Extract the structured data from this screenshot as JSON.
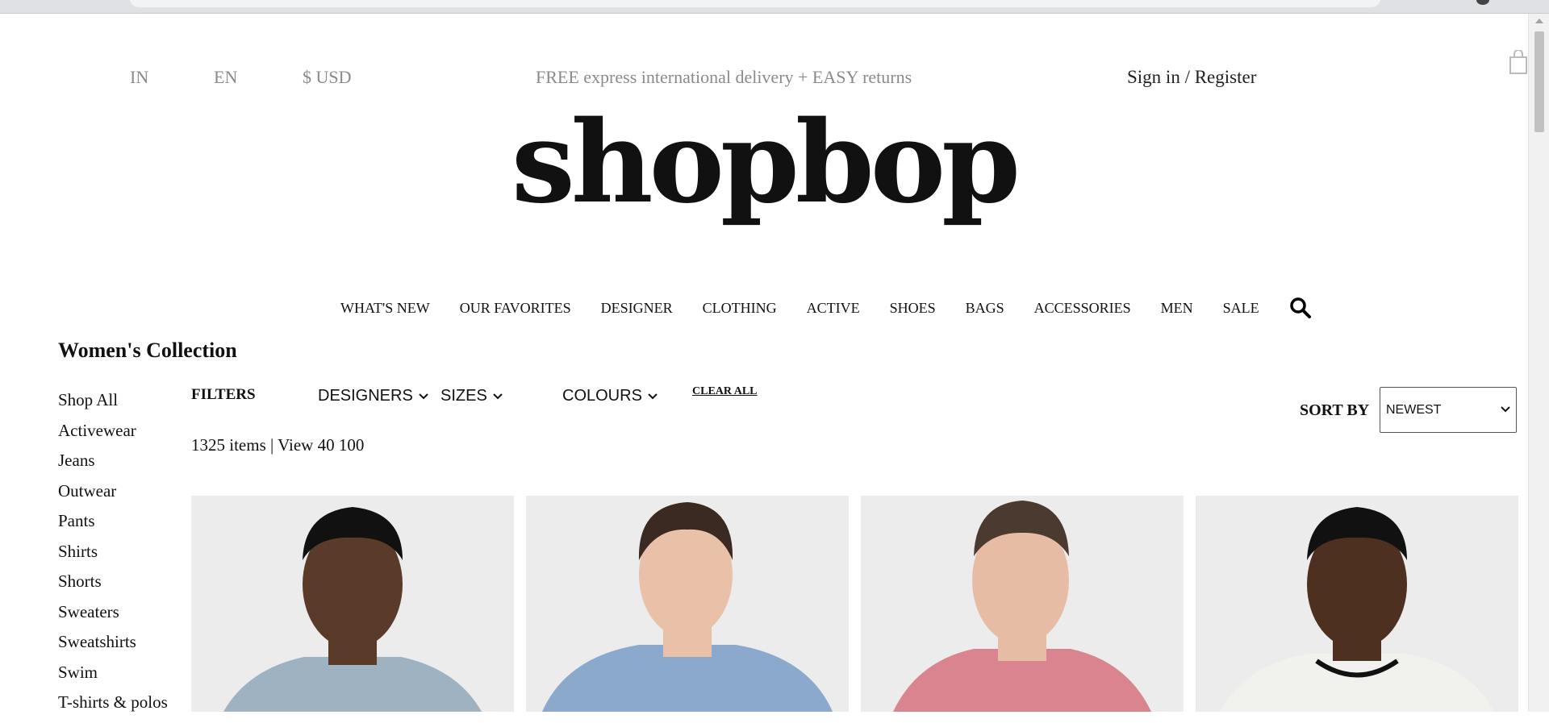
{
  "topbar": {
    "country": "IN",
    "language": "EN",
    "currency": "$ USD",
    "promo": "FREE express international delivery + EASY returns",
    "signin": "Sign in / Register"
  },
  "logo": {
    "text": "shopbop"
  },
  "nav": {
    "items": [
      "WHAT'S NEW",
      "OUR FAVORITES",
      "DESIGNER",
      "CLOTHING",
      "ACTIVE",
      "SHOES",
      "BAGS",
      "ACCESSORIES",
      "MEN",
      "SALE"
    ],
    "search_icon": "search-icon"
  },
  "page": {
    "title": "Women's Collection"
  },
  "sidebar": {
    "items": [
      "Shop All",
      "Activewear",
      "Jeans",
      "Outwear",
      "Pants",
      "Shirts",
      "Shorts",
      "Sweaters",
      "Sweatshirts",
      "Swim",
      "T-shirts & polos"
    ]
  },
  "filters": {
    "label": "FILTERS",
    "designers": "DESIGNERS",
    "sizes": "SIZES",
    "colours": "COLOURS",
    "clear_all": "CLEAR ALL"
  },
  "results": {
    "count": "1325 items",
    "separator": "|",
    "view_label": "View",
    "view_40": "40",
    "view_100": "100"
  },
  "sort": {
    "label": "SORT BY",
    "selected": "NEWEST"
  },
  "products": [
    {
      "shirt_color": "#9fb2c2",
      "skin_color": "#5a3a28",
      "hair_color": "#111111"
    },
    {
      "shirt_color": "#8aa9cc",
      "skin_color": "#e8c1a8",
      "hair_color": "#3a2a22"
    },
    {
      "shirt_color": "#d9848f",
      "skin_color": "#e6bda4",
      "hair_color": "#4a3a30"
    },
    {
      "shirt_color": "#f1f1ee",
      "skin_color": "#4e3020",
      "hair_color": "#111111"
    }
  ]
}
